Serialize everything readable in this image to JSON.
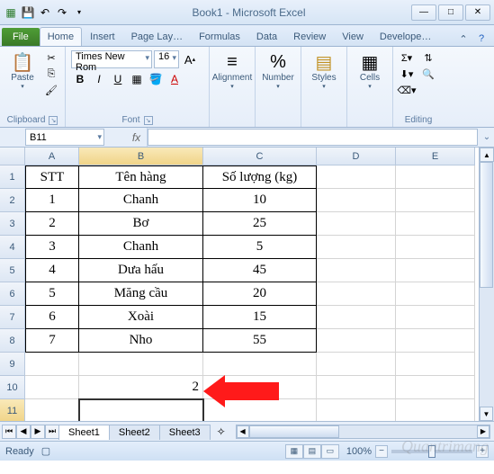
{
  "window": {
    "title": "Book1 - Microsoft Excel"
  },
  "qat": {
    "save": "💾",
    "undo": "↶",
    "redo": "↷"
  },
  "tabs": {
    "file": "File",
    "items": [
      "Home",
      "Insert",
      "Page Lay…",
      "Formulas",
      "Data",
      "Review",
      "View",
      "Develope…"
    ],
    "active": 0
  },
  "ribbon": {
    "clipboard": {
      "label": "Clipboard",
      "paste": "Paste"
    },
    "font": {
      "label": "Font",
      "name": "Times New Rom",
      "size": "16",
      "bold": "B",
      "italic": "I",
      "underline": "U",
      "grow": "A",
      "shrink": "A"
    },
    "alignment": {
      "label": "Alignment"
    },
    "number": {
      "label": "Number"
    },
    "styles": {
      "label": "Styles"
    },
    "cells": {
      "label": "Cells"
    },
    "editing": {
      "label": "Editing"
    }
  },
  "namebox": "B11",
  "formula": "",
  "columns": [
    "A",
    "B",
    "C",
    "D",
    "E"
  ],
  "rows": [
    "1",
    "2",
    "3",
    "4",
    "5",
    "6",
    "7",
    "8",
    "9",
    "10",
    "11"
  ],
  "table": {
    "header": {
      "a": "STT",
      "b": "Tên hàng",
      "c": "Số lượng (kg)"
    },
    "rows": [
      {
        "a": "1",
        "b": "Chanh",
        "c": "10"
      },
      {
        "a": "2",
        "b": "Bơ",
        "c": "25"
      },
      {
        "a": "3",
        "b": "Chanh",
        "c": "5"
      },
      {
        "a": "4",
        "b": "Dưa hấu",
        "c": "45"
      },
      {
        "a": "5",
        "b": "Măng cầu",
        "c": "20"
      },
      {
        "a": "6",
        "b": "Xoài",
        "c": "15"
      },
      {
        "a": "7",
        "b": "Nho",
        "c": "55"
      }
    ]
  },
  "b10": "2",
  "sheets": [
    "Sheet1",
    "Sheet2",
    "Sheet3"
  ],
  "status": {
    "ready": "Ready",
    "zoom": "100%"
  },
  "watermark": "Quantrimang"
}
